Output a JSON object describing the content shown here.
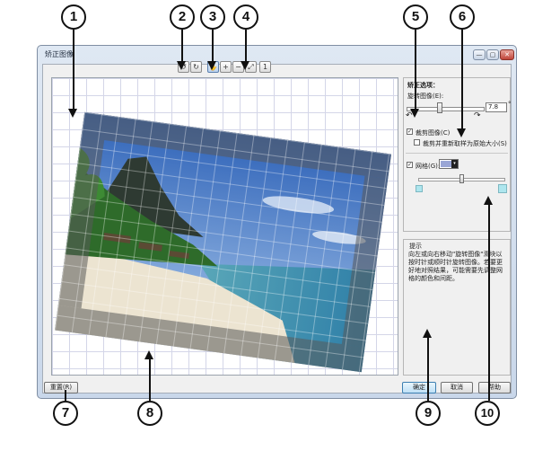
{
  "window": {
    "title": "矫正图像"
  },
  "window_controls": [
    "—",
    "▢",
    "✕"
  ],
  "toolbar": [
    {
      "name": "rotate-left-icon",
      "glyph": "↺"
    },
    {
      "name": "rotate-right-icon",
      "glyph": "↻"
    },
    {
      "name": "pan-hand-icon",
      "glyph": "✋"
    },
    {
      "name": "zoom-in-icon",
      "glyph": "+"
    },
    {
      "name": "zoom-out-icon",
      "glyph": "−"
    },
    {
      "name": "zoom-fit-icon",
      "glyph": "⤢"
    },
    {
      "name": "zoom-actual-icon",
      "glyph": "1"
    }
  ],
  "options": {
    "heading": "矫正选项：",
    "rotate_label": "旋转图像(E):",
    "rotate_value": "7.8",
    "rotate_unit": "°",
    "slider_left_glyph": "↶",
    "slider_right_glyph": "↷",
    "crop_label": "裁剪图像(C)",
    "crop_checked": "✓",
    "resize_label": "裁剪并重新取样为原始大小(S)",
    "grid_label": "网格(G):",
    "grid_checked": "✓",
    "grid_color": "#9aa6d6"
  },
  "hint": {
    "title": "提示",
    "text": "向左或向右移动\"旋转图像\"滑块以按时针或顺时针旋转图像。若要更好地对照结果，可能需要先调整网格的颜色和间距。"
  },
  "buttons": {
    "reset": "重置(R)",
    "ok": "确定",
    "cancel": "取消",
    "help": "帮助"
  },
  "callouts": [
    "1",
    "2",
    "3",
    "4",
    "5",
    "6",
    "7",
    "8",
    "9",
    "10"
  ]
}
